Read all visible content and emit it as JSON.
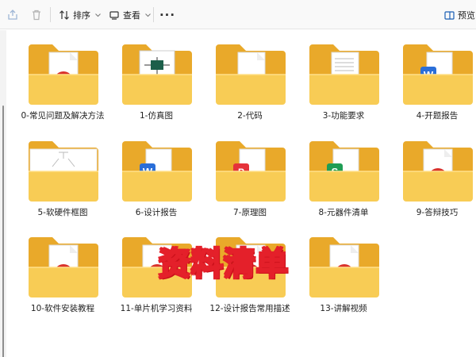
{
  "toolbar": {
    "sort_label": "排序",
    "view_label": "查看",
    "more_label": "···",
    "preview_label": "预览"
  },
  "folders": [
    {
      "name": "0-常见问题及解决方法",
      "preview": "red-doc"
    },
    {
      "name": "1-仿真图",
      "preview": "schematic"
    },
    {
      "name": "2-代码",
      "preview": "blank-page"
    },
    {
      "name": "3-功能要求",
      "preview": "text-page"
    },
    {
      "name": "4-开题报告",
      "preview": "word"
    },
    {
      "name": "5-软硬件框图",
      "preview": "diagram"
    },
    {
      "name": "6-设计报告",
      "preview": "word"
    },
    {
      "name": "7-原理图",
      "preview": "pdf"
    },
    {
      "name": "8-元器件清单",
      "preview": "sheet"
    },
    {
      "name": "9-答辩技巧",
      "preview": "red-doc"
    },
    {
      "name": "10-软件安装教程",
      "preview": "red-doc"
    },
    {
      "name": "11-单片机学习资料",
      "preview": "red-doc"
    },
    {
      "name": "12-设计报告常用描述",
      "preview": "red-doc"
    },
    {
      "name": "13-讲解视频",
      "preview": "red-doc"
    }
  ],
  "overlay_text": "资料清单"
}
